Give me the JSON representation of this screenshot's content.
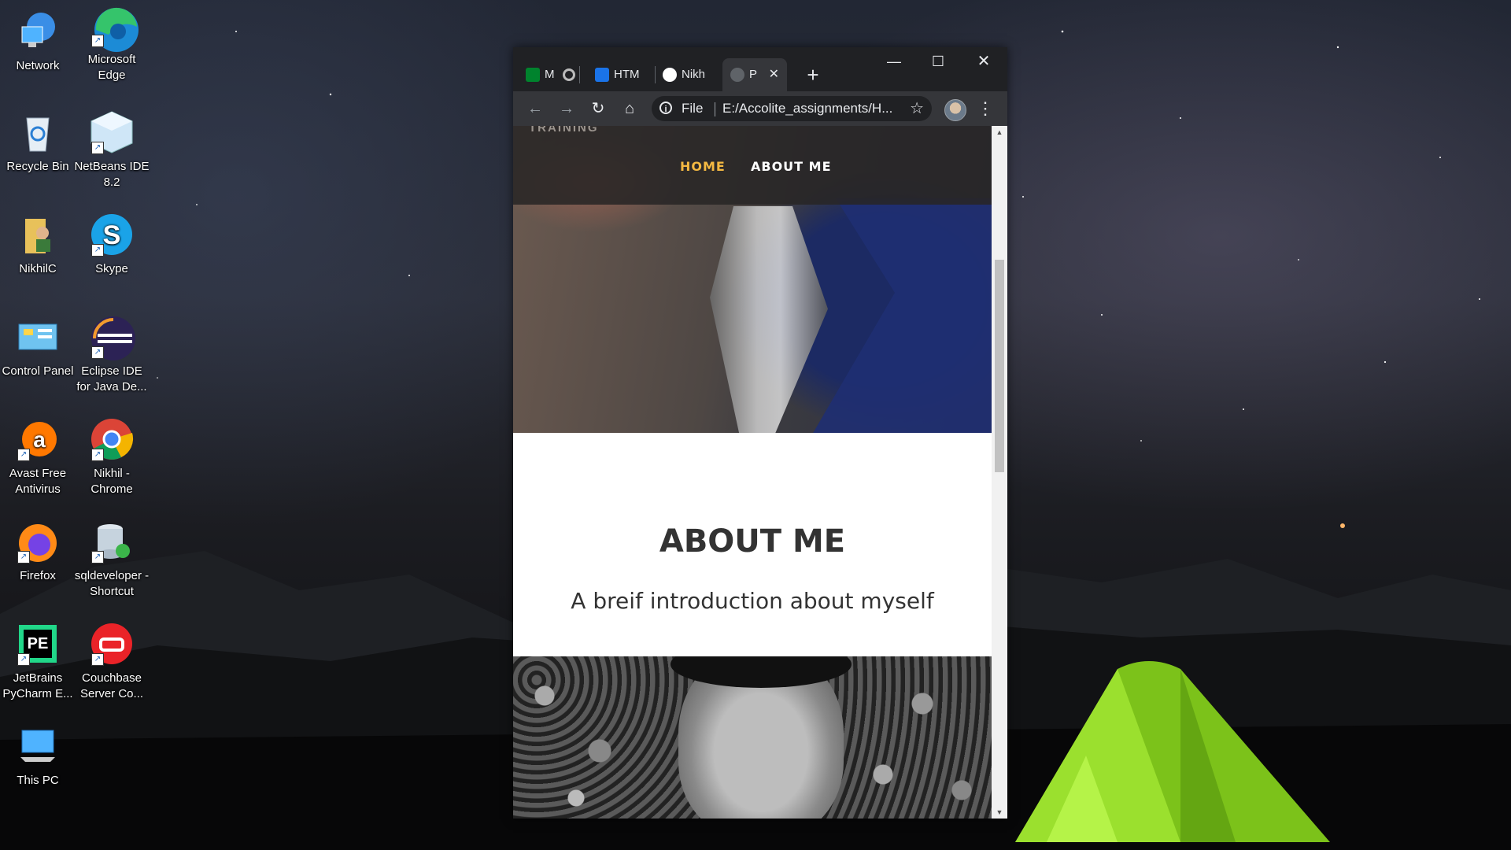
{
  "desktop": {
    "icons": [
      {
        "label": "Network",
        "icon": "network-icon"
      },
      {
        "label": "Microsoft Edge",
        "icon": "edge-icon"
      },
      {
        "label": "Recycle Bin",
        "icon": "recycle-bin-icon"
      },
      {
        "label": "NetBeans IDE 8.2",
        "icon": "netbeans-icon"
      },
      {
        "label": "NikhilC",
        "icon": "user-folder-icon"
      },
      {
        "label": "Skype",
        "icon": "skype-icon"
      },
      {
        "label": "Control Panel",
        "icon": "control-panel-icon"
      },
      {
        "label": "Eclipse IDE for Java De...",
        "icon": "eclipse-icon"
      },
      {
        "label": "Avast Free Antivirus",
        "icon": "avast-icon"
      },
      {
        "label": "Nikhil - Chrome",
        "icon": "chrome-icon"
      },
      {
        "label": "Firefox",
        "icon": "firefox-icon"
      },
      {
        "label": "sqldeveloper - Shortcut",
        "icon": "sqldeveloper-icon"
      },
      {
        "label": "JetBrains PyCharm E...",
        "icon": "pycharm-icon"
      },
      {
        "label": "Couchbase Server Co...",
        "icon": "couchbase-icon"
      },
      {
        "label": "This PC",
        "icon": "this-pc-icon"
      }
    ]
  },
  "browser": {
    "tabs": [
      {
        "label": "M",
        "icon": "meet-icon"
      },
      {
        "label": "HTM",
        "icon": "classroom-icon"
      },
      {
        "label": "Nikh",
        "icon": "github-icon"
      },
      {
        "label": "P",
        "icon": "globe-icon",
        "active": true
      }
    ],
    "new_tab": "+",
    "omnibox": {
      "scheme": "File",
      "url": "E:/Accolite_assignments/H..."
    },
    "colors": {
      "frame": "#202124",
      "toolbar": "#35363a"
    }
  },
  "page": {
    "brand": "TRAINING",
    "nav": [
      {
        "label": "HOME",
        "color": "#f4b942"
      },
      {
        "label": "ABOUT ME",
        "color": "#ffffff"
      }
    ],
    "about_title": "ABOUT ME",
    "about_subtitle": "A breif introduction about myself"
  }
}
